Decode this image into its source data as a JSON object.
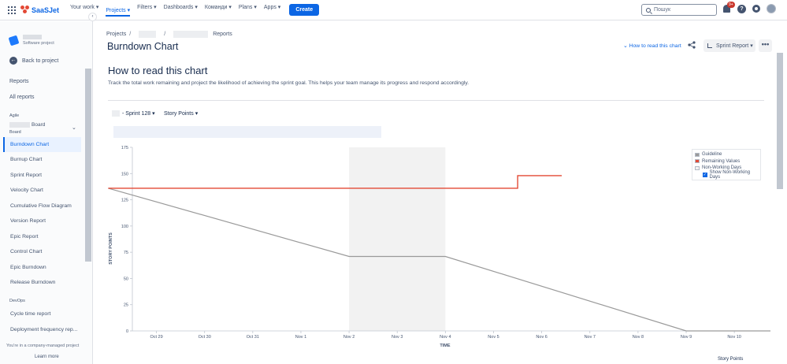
{
  "topnav": {
    "logo": "SaaSJet",
    "items": [
      {
        "label": "Your work",
        "active": false
      },
      {
        "label": "Projects",
        "active": true
      },
      {
        "label": "Filters",
        "active": false
      },
      {
        "label": "Dashboards",
        "active": false
      },
      {
        "label": "Команди",
        "active": false
      },
      {
        "label": "Plans",
        "active": false
      },
      {
        "label": "Apps",
        "active": false
      }
    ],
    "create_label": "Create",
    "search_placeholder": "Пошук",
    "notifications_badge": "9+",
    "help_glyph": "?"
  },
  "sidebar": {
    "project_type": "Software project",
    "collapse_glyph": "‹",
    "back_label": "Back to project",
    "back_glyph": "←",
    "reports_heading": "Reports",
    "all_reports": "All reports",
    "agile_heading": "Agile",
    "board_label": "Board",
    "board_sub": "Board",
    "chevron": "⌄",
    "agile_items": [
      {
        "label": "Burndown Chart",
        "active": true
      },
      {
        "label": "Burnup Chart",
        "active": false
      },
      {
        "label": "Sprint Report",
        "active": false
      },
      {
        "label": "Velocity Chart",
        "active": false
      },
      {
        "label": "Cumulative Flow Diagram",
        "active": false
      },
      {
        "label": "Version Report",
        "active": false
      },
      {
        "label": "Epic Report",
        "active": false
      },
      {
        "label": "Control Chart",
        "active": false
      },
      {
        "label": "Epic Burndown",
        "active": false
      },
      {
        "label": "Release Burndown",
        "active": false
      }
    ],
    "devops_heading": "DevOps",
    "devops_items": [
      {
        "label": "Cycle time report"
      },
      {
        "label": "Deployment frequency rep..."
      }
    ],
    "footer_text": "You're in a company-managed project",
    "learn_more": "Learn more"
  },
  "header": {
    "breadcrumbs": [
      "Projects",
      "/",
      "/",
      "Reports"
    ],
    "title": "Burndown Chart",
    "howto_link": "How to read this chart",
    "report_button": "Sprint Report",
    "more": "•••"
  },
  "main": {
    "heading": "How to read this chart",
    "description": "Track the total work remaining and project the likelihood of achieving the sprint goal. This helps your team manage its progress and respond accordingly.",
    "sprint_select": "- Sprint 128",
    "estimate_select": "Story Points",
    "footer_label": "Story Points"
  },
  "legend": {
    "guideline": "Guideline",
    "remaining": "Remaining Values",
    "nonworking": "Non-Working Days",
    "show_nonworking": "Show Non-Working Days",
    "checkbox_glyph": "✓"
  },
  "colors": {
    "guideline": "#9a9a9a",
    "remaining": "#e34935",
    "nonworking": "#f2f2f2",
    "accent": "#0c66e4"
  },
  "chart_data": {
    "type": "line",
    "xlabel": "TIME",
    "ylabel": "STORY POINTS",
    "ylim": [
      0,
      175
    ],
    "yticks": [
      0,
      25,
      50,
      75,
      100,
      125,
      150,
      175
    ],
    "x_dates": [
      "Oct 29",
      "Oct 30",
      "Oct 31",
      "Nov 1",
      "Nov 2",
      "Nov 3",
      "Nov 4",
      "Nov 5",
      "Nov 6",
      "Nov 7",
      "Nov 8",
      "Nov 9",
      "Nov 10"
    ],
    "xlim": [
      "Oct 28 12:00",
      "Nov 10 18:00"
    ],
    "nonworking_periods": [
      [
        "Nov 2",
        "Nov 4"
      ]
    ],
    "series": [
      {
        "name": "Guideline",
        "points": [
          [
            "Oct 28",
            136
          ],
          [
            "Nov 2",
            71
          ],
          [
            "Nov 4",
            71
          ],
          [
            "Nov 9",
            0
          ],
          [
            "Nov 10 18:00",
            0
          ]
        ]
      },
      {
        "name": "Remaining Values",
        "points": [
          [
            "Oct 28",
            136
          ],
          [
            "Nov 5 12:00",
            136
          ],
          [
            "Nov 5 12:00",
            148
          ],
          [
            "Nov 6 10:00",
            148
          ]
        ]
      }
    ]
  }
}
